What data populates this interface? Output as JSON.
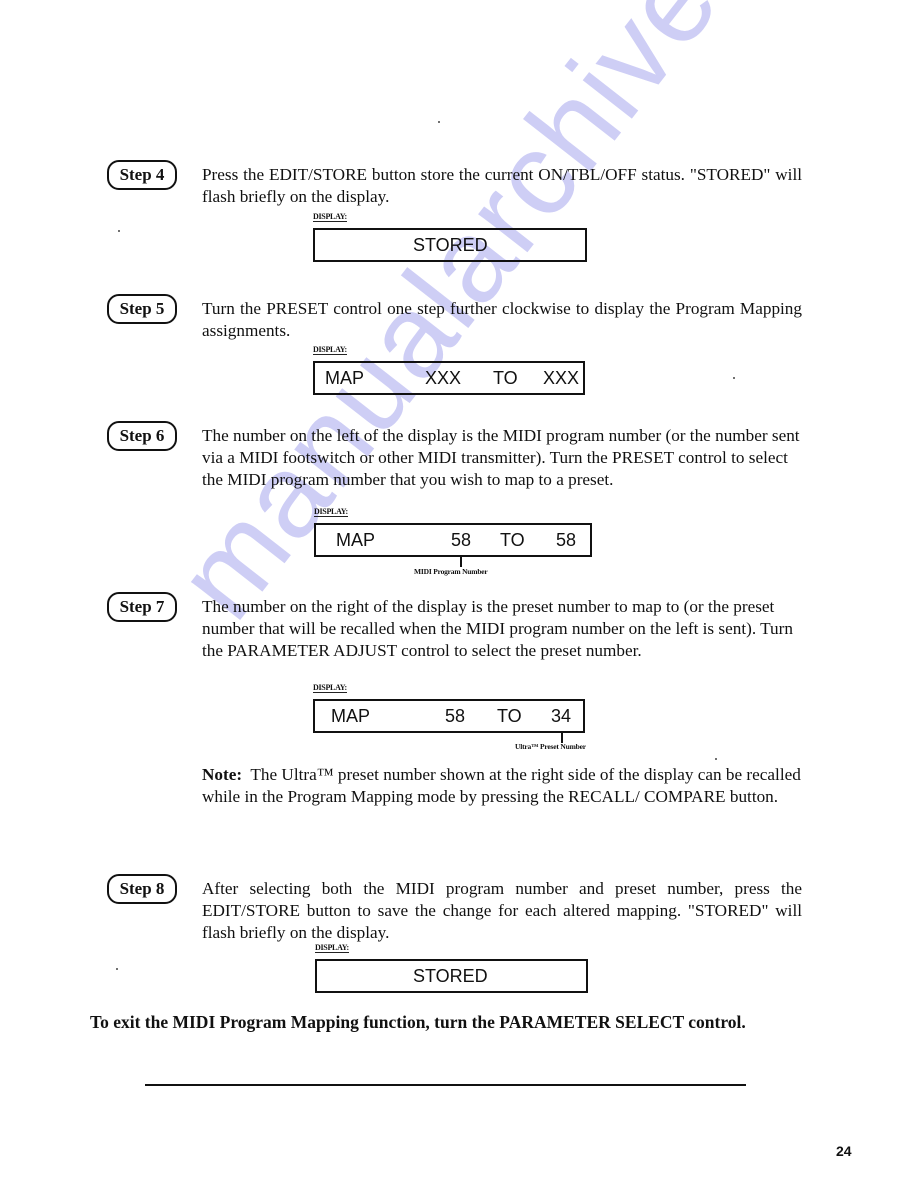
{
  "watermark": "manualarchive.com",
  "colors": {
    "watermark": "#c9c9f5",
    "ink": "#111111"
  },
  "display_label": "DISPLAY:",
  "steps": [
    {
      "badge": "Step 4",
      "text": "Press the EDIT/STORE button store the current ON/TBL/OFF status. \"STORED\" will flash briefly on the display.",
      "display": {
        "center": "STORED"
      }
    },
    {
      "badge": "Step 5",
      "text": "Turn the PRESET control one step further clockwise to display the Program Mapping assignments.",
      "display": {
        "mode": "MAP",
        "midi_program": "XXX",
        "to": "TO",
        "preset": "XXX"
      }
    },
    {
      "badge": "Step 6",
      "text": "The number on the left of the display is the MIDI program number (or the number sent via a MIDI footswitch or other MIDI transmitter). Turn the PRESET control to select the MIDI program number that you wish to map to a preset.",
      "display": {
        "mode": "MAP",
        "midi_program": "58",
        "to": "TO",
        "preset": "58",
        "caption": "MIDI Program Number"
      }
    },
    {
      "badge": "Step 7",
      "text": "The number on the right of the display is the preset number to map to (or the preset number that will be recalled when the MIDI program number on the left is sent). Turn the PARAMETER ADJUST control to select the preset number.",
      "display": {
        "mode": "MAP",
        "midi_program": "58",
        "to": "TO",
        "preset": "34",
        "caption": "Ultra™ Preset Number"
      }
    },
    {
      "badge": "Step 8",
      "text": "After selecting both the MIDI program number and preset number, press the EDIT/STORE button to save the change for each altered mapping. \"STORED\" will flash briefly on the display.",
      "display": {
        "center": "STORED"
      }
    }
  ],
  "note": {
    "label": "Note:",
    "text": "The Ultra™ preset number shown at the right side of the display can be recalled while in the Program Mapping mode by pressing the RECALL/ COMPARE button."
  },
  "exit_instruction": "To exit the MIDI Program Mapping function, turn the PARAMETER SELECT control.",
  "page_number": "24"
}
